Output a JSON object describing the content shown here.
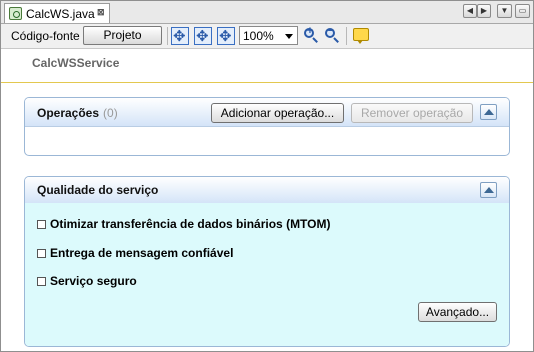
{
  "tab": {
    "title": "CalcWS.java",
    "close_glyph": "⊠"
  },
  "window_controls": {
    "prev": "◀",
    "next": "▶",
    "menu": "▼",
    "restore": "▭"
  },
  "toolbar": {
    "source_label": "Código-fonte",
    "design_label": "Projeto",
    "zoom": "100%"
  },
  "service": {
    "name": "CalcWSService"
  },
  "operations": {
    "title": "Operações",
    "count": "(0)",
    "add_label": "Adicionar operação...",
    "remove_label": "Remover operação"
  },
  "qos": {
    "title": "Qualidade do serviço",
    "options": [
      {
        "label": "Otimizar transferência de dados binários (MTOM)",
        "checked": false
      },
      {
        "label": "Entrega de mensagem confiável",
        "checked": false
      },
      {
        "label": "Serviço seguro",
        "checked": false
      }
    ],
    "advanced_label": "Avançado..."
  },
  "colors": {
    "panel_border": "#9bb7d6",
    "qos_body": "#dcfafc",
    "accent_line": "#e3c84f"
  }
}
